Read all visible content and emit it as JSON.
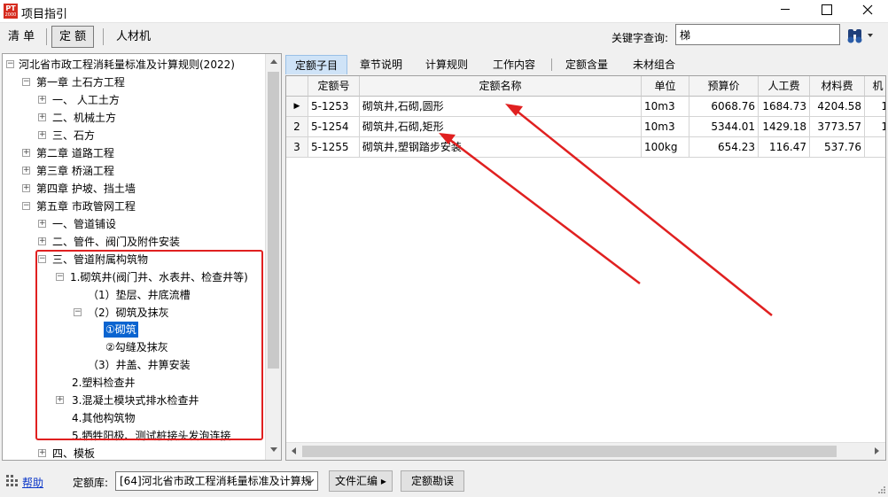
{
  "window": {
    "title": "项目指引",
    "icon_text": "PT",
    "icon_subtext": "2000"
  },
  "toolbar": {
    "qingdan_label": "清  单",
    "dinge_label": "定  额",
    "rencaiji_label": "人材机",
    "keyword_label": "关键字查询:",
    "keyword_value": "梯",
    "search_icon": "binoculars-icon"
  },
  "tree": {
    "root": "河北省市政工程消耗量标准及计算规则(2022)",
    "ch1": "第一章 土石方工程",
    "ch1_1": "一、 人工土方",
    "ch1_2": "二、机械土方",
    "ch1_3": "三、石方",
    "ch2": "第二章 道路工程",
    "ch3": "第三章 桥涵工程",
    "ch4": "第四章 护坡、挡土墙",
    "ch5": "第五章 市政管网工程",
    "ch5_1": "一、管道铺设",
    "ch5_2": "二、管件、阀门及附件安装",
    "ch5_3": "三、管道附属构筑物",
    "ch5_3_1": "1.砌筑井(阀门井、水表井、检查井等)",
    "ch5_3_1_1": "（1）垫层、井底流槽",
    "ch5_3_1_2": "（2）砌筑及抹灰",
    "ch5_3_1_2_a": "①砌筑",
    "ch5_3_1_2_b": "②勾缝及抹灰",
    "ch5_3_1_3": "（3）井盖、井箅安装",
    "ch5_3_2": "2.塑料检查井",
    "ch5_3_3": "3.混凝土模块式排水检查井",
    "ch5_3_4": "4.其他构筑物",
    "ch5_3_5": "5.牺牲阳极、测试桩接头发泡连接",
    "ch5_4": "四、模板"
  },
  "tabs": [
    "定额子目",
    "章节说明",
    "计算规则",
    "工作内容",
    "定额含量",
    "未材组合"
  ],
  "grid": {
    "headers": [
      "",
      "定额号",
      "定额名称",
      "单位",
      "预算价",
      "人工费",
      "材料费",
      "机"
    ],
    "rows": [
      {
        "idx": "▶",
        "code": "5-1253",
        "name": "砌筑井,石砌,圆形",
        "unit": "10m3",
        "price": "6068.76",
        "labor": "1684.73",
        "material": "4204.58",
        "mach": "1"
      },
      {
        "idx": "2",
        "code": "5-1254",
        "name": "砌筑井,石砌,矩形",
        "unit": "10m3",
        "price": "5344.01",
        "labor": "1429.18",
        "material": "3773.57",
        "mach": "1"
      },
      {
        "idx": "3",
        "code": "5-1255",
        "name": "砌筑井,塑钢踏步安装",
        "unit": "100kg",
        "price": "654.23",
        "labor": "116.47",
        "material": "537.76",
        "mach": ""
      }
    ]
  },
  "status": {
    "help_label": "帮助",
    "lib_label": "定额库:",
    "lib_value": "[64]河北省市政工程消耗量标准及计算规",
    "file_btn": "文件汇编 ▸",
    "errata_btn": "定额勘误"
  },
  "colors": {
    "selected": "#0a64d0",
    "annotation": "#e02020",
    "active_tab": "#cfe3f7"
  }
}
